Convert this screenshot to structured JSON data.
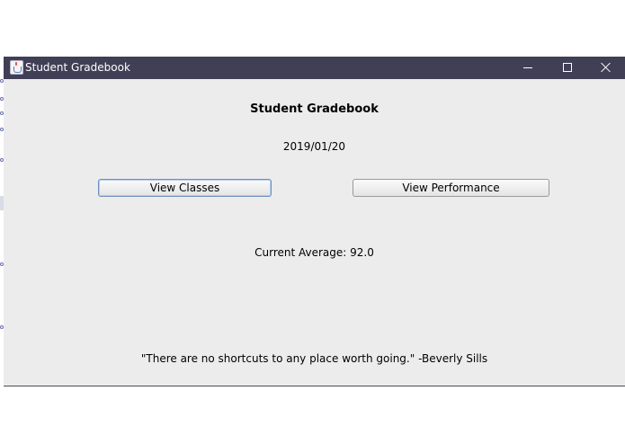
{
  "window": {
    "title": "Student Gradebook"
  },
  "main": {
    "heading": "Student Gradebook",
    "date": "2019/01/20",
    "view_classes_label": "View Classes",
    "view_performance_label": "View Performance",
    "current_average": "Current Average: 92.0",
    "quote": "\"There are no shortcuts to any place worth going.\" -Beverly Sills"
  },
  "icons": {
    "app": "java-app-icon",
    "minimize": "minimize-icon",
    "maximize": "maximize-icon",
    "close": "close-icon"
  },
  "colors": {
    "titlebar": "#403f55",
    "window_background": "#ececec",
    "focused_button_border": "#6f8fc0"
  }
}
